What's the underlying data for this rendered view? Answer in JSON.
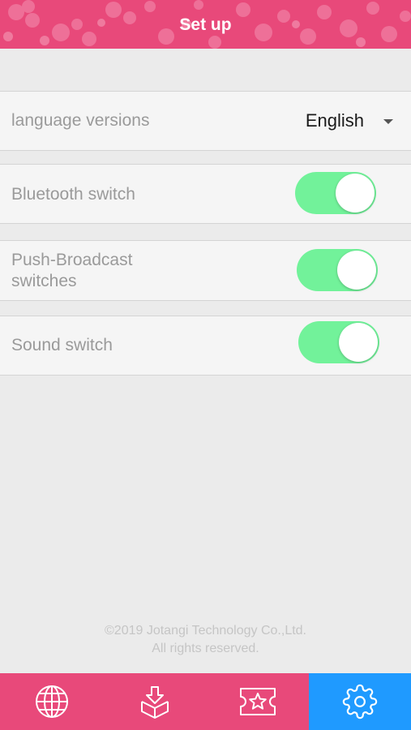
{
  "header": {
    "title": "Set up"
  },
  "settings": {
    "language": {
      "label": "language versions",
      "value": "English"
    },
    "bluetooth": {
      "label": "Bluetooth switch",
      "on": true
    },
    "push": {
      "label_line1": "Push-Broadcast",
      "label_line2": "switches",
      "on": true
    },
    "sound": {
      "label": "Sound switch",
      "on": true
    }
  },
  "footer": {
    "copyright": "©2019 Jotangi Technology Co.,Ltd.",
    "rights": "All rights reserved."
  },
  "tabbar": {
    "tabs": [
      {
        "icon": "globe-icon"
      },
      {
        "icon": "download-box-icon"
      },
      {
        "icon": "star-ticket-icon"
      },
      {
        "icon": "gear-icon",
        "active": true
      }
    ]
  },
  "colors": {
    "brand_pink": "#e8497a",
    "active_tab": "#1f9aff",
    "toggle_on": "#72f29a",
    "background": "#ebebeb"
  }
}
